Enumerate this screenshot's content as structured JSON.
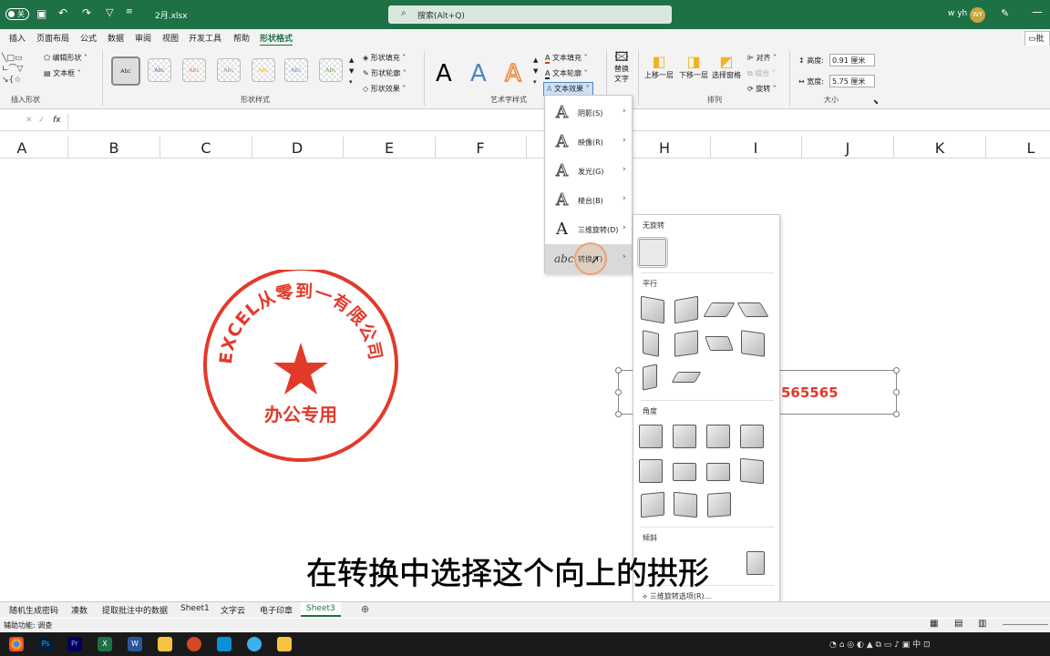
{
  "titlebar": {
    "filename": "2月.xlsx",
    "search_placeholder": "搜索(Alt+Q)",
    "user_name": "w yh",
    "user_initials": "WY",
    "toggle_label": "关"
  },
  "tabs": [
    "插入",
    "页面布局",
    "公式",
    "数据",
    "审阅",
    "视图",
    "开发工具",
    "帮助",
    "形状格式"
  ],
  "active_tab": "形状格式",
  "ribbon": {
    "insert_shapes": {
      "edit_shape": "编辑形状",
      "text_box": "文本框",
      "group": "插入形状"
    },
    "shape_styles": {
      "sample": "Abc",
      "fill": "形状填充",
      "outline": "形状轮廓",
      "effects": "形状效果",
      "group": "形状样式"
    },
    "wordart": {
      "letter": "A",
      "text_fill": "文本填充",
      "text_outline": "文本轮廓",
      "text_effects": "文本效果",
      "group": "艺术字样式"
    },
    "alt_text": "替换文字",
    "arrange": {
      "bring_forward": "上移一层",
      "send_backward": "下移一层",
      "selection_pane": "选择窗格",
      "align": "对齐",
      "group_btn": "组合",
      "rotate": "旋转",
      "group": "排列"
    },
    "size": {
      "height_label": "高度:",
      "height": "0.91 厘米",
      "width_label": "宽度:",
      "width": "5.75 厘米",
      "group": "大小"
    },
    "comments": "批注"
  },
  "formula_bar": {
    "fx": "fx"
  },
  "columns": [
    "A",
    "B",
    "C",
    "D",
    "E",
    "F",
    "H",
    "I",
    "J",
    "K",
    "L"
  ],
  "stamp": {
    "arc_text": "EXCEL从零到一有限公司",
    "bottom_text": "办公专用",
    "color": "#e23a2a"
  },
  "textbox_text": "565565",
  "menu1": [
    {
      "label": "阴影(S)",
      "icon": "A"
    },
    {
      "label": "映像(R)",
      "icon": "A"
    },
    {
      "label": "发光(G)",
      "icon": "A"
    },
    {
      "label": "棱台(B)",
      "icon": "A"
    },
    {
      "label": "三维旋转(D)",
      "icon": "A"
    },
    {
      "label": "转换(T)",
      "icon": "abc"
    }
  ],
  "menu2": {
    "no_rotation": "无旋转",
    "parallel": "平行",
    "angle": "角度",
    "tilt": "倾斜",
    "options": "三维旋转选项(R)..."
  },
  "sheet_tabs": [
    "随机生成密码",
    "凑数",
    "提取批注中的数据",
    "Sheet1",
    "文字云",
    "电子印章",
    "Sheet3"
  ],
  "active_sheet": "Sheet3",
  "status": {
    "accessibility": "辅助功能: 调查"
  },
  "caption": "在转换中选择这个向上的拱形",
  "accent_color": "#1e7145"
}
